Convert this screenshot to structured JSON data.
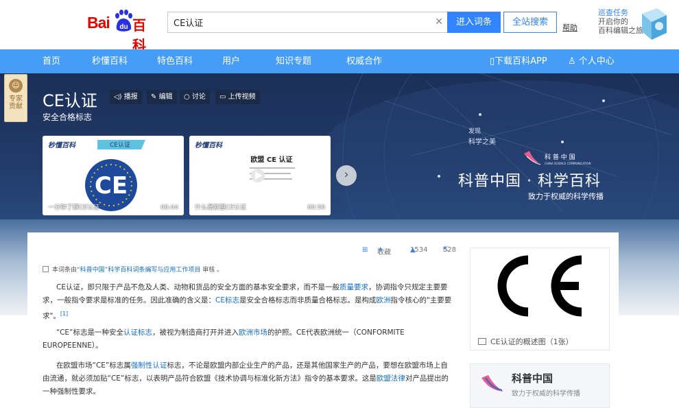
{
  "header": {
    "logo_bai": "Bai",
    "logo_paw_text": "du",
    "logo_baike": "百科",
    "search_value": "CE认证",
    "clear_icon": "close-icon",
    "enter_label": "进入词条",
    "site_search_label": "全站搜索",
    "help_label": "帮助",
    "task_line1": "巡查任务",
    "task_line2": "开启你的",
    "task_line3": "百科编辑之旅"
  },
  "nav": {
    "items": [
      "首页",
      "秒懂百科",
      "特色百科",
      "用户",
      "知识专题",
      "权威合作"
    ],
    "app_label": "下载百科APP",
    "user_label": "个人中心"
  },
  "hero": {
    "expert_line1": "专家",
    "expert_line2": "贡献",
    "title": "CE认证",
    "subtitle": "安全合格标志",
    "actions": [
      "播报",
      "编辑",
      "讨论",
      "上传视频"
    ],
    "videos": [
      {
        "brand": "秒懂百科",
        "tag": "CE认证",
        "caption": "一分钟了解CE认证",
        "duration": "00:44"
      },
      {
        "brand": "秒懂百科",
        "heading": "欧盟 CE 认证",
        "caption": "什么是欧盟CE认证",
        "duration": "00:50"
      }
    ],
    "discover_small1": "发现",
    "discover_small2": "科学之美",
    "sci_brand": "科 普 中 国",
    "sci_brand_en": "CHINA SCIENCE COMMUNICATION",
    "sci_title": "科普中国 · 科学百科",
    "sci_sub": "致力于权威的科学传播"
  },
  "toolbar": {
    "collect_label": "收藏",
    "like_count": "1534",
    "share_count": "528"
  },
  "article": {
    "review_prefix": "本词条由",
    "review_link": "“科普中国”科学百科词条编写与应用工作项目",
    "review_suffix": " 审核 。",
    "p1_a": "CE认证，即只限于产品不危及人类、动物和货品的安全方面的基本安全要求，而不是一般",
    "p1_link1": "质量要求",
    "p1_b": "，协调指令只规定主要要求，一般指令要求是标准的任务。因此准确的含义是：",
    "p1_link2": "CE标志",
    "p1_c": "是安全合格标志而非质量合格标志。是构成",
    "p1_link3": "欧洲",
    "p1_d": "指令核心的\"主要要求\"。",
    "p1_ref": "[1]",
    "p2_a": "“CE”标志是一种安全",
    "p2_link1": "认证标志",
    "p2_b": "，被视为制造商打开并进入",
    "p2_link2": "欧洲市场",
    "p2_c": "的护照。CE代表欧洲统一（CONFORMITE EUROPEENNE）。",
    "p3_a": "在欧盟市场“CE”标志属",
    "p3_link1": "强制性认证",
    "p3_b": "标志，不论是欧盟内部企业生产的产品，还是其他国家生产的产品，要想在欧盟市场上自由流通，就必须加贴“CE”标志，以表明产品符合欧盟《技术协调与标准化新方法》指令的基本要求。这是",
    "p3_link2": "欧盟法律",
    "p3_c": "对产品提出的一种强制性要求。"
  },
  "sidebar": {
    "ce_letters": "CE",
    "ce_caption": "CE认证的概述图（1张）",
    "card_title": "科普中国",
    "card_sub": "致力于权威的科学传播"
  }
}
